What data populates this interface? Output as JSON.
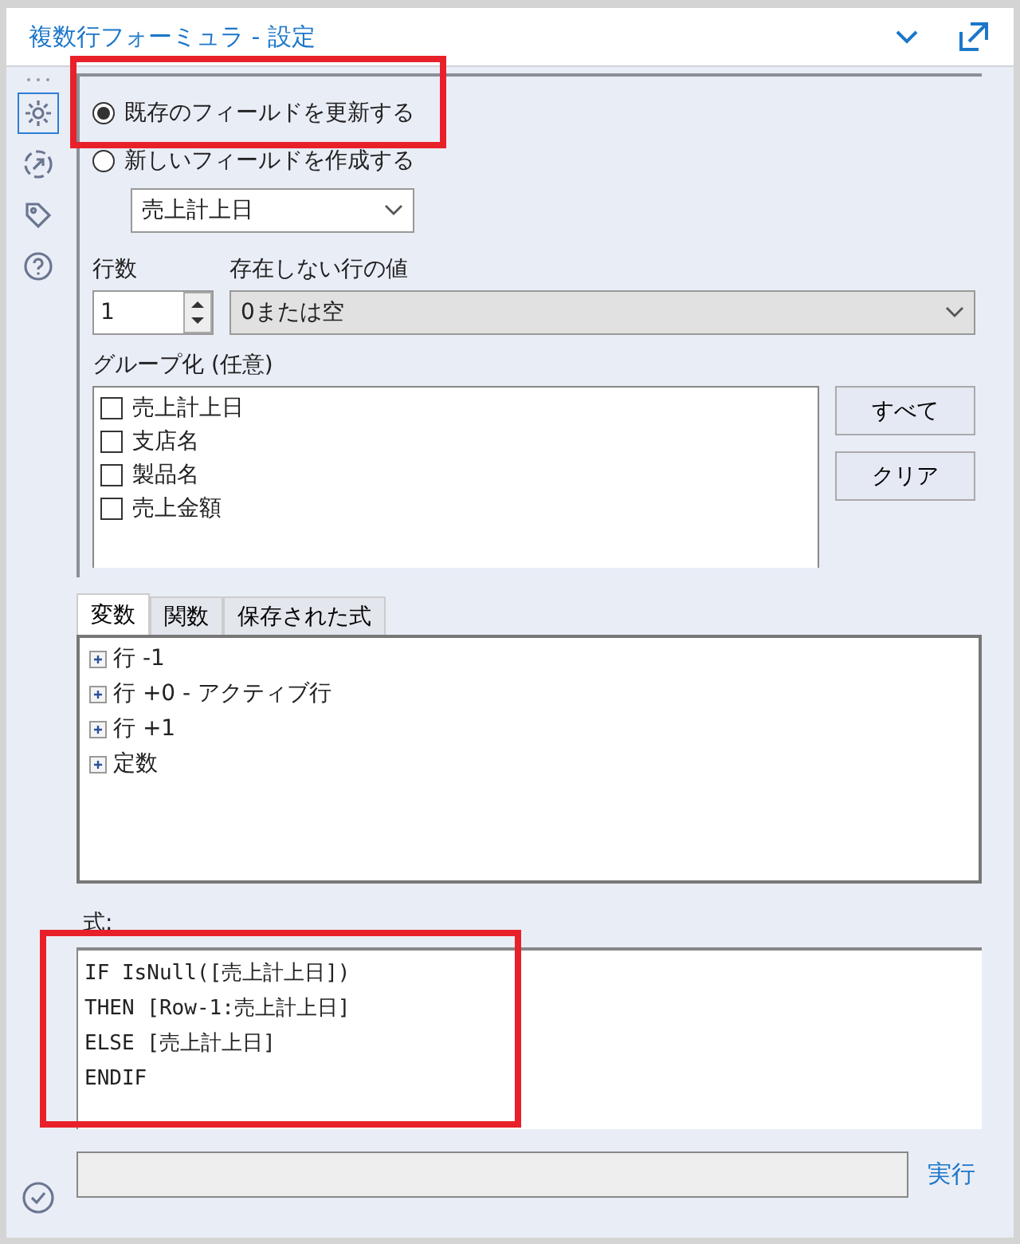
{
  "window": {
    "title": "複数行フォーミュラ - 設定"
  },
  "rail": [
    {
      "kind": "dots"
    },
    {
      "kind": "gear",
      "selected": true
    },
    {
      "kind": "connect",
      "selected": false
    },
    {
      "kind": "tag",
      "selected": false
    },
    {
      "kind": "help",
      "selected": false
    }
  ],
  "mode_options": [
    {
      "label": "既存のフィールドを更新する",
      "selected": true
    },
    {
      "label": "新しいフィールドを作成する",
      "selected": false
    }
  ],
  "field_dropdown": {
    "value": "売上計上日"
  },
  "row_count": {
    "label": "行数",
    "value": "1"
  },
  "missing_rows": {
    "label": "存在しない行の値",
    "value": "0または空"
  },
  "grouping": {
    "label": "グループ化 (任意)",
    "items": [
      {
        "label": "売上計上日",
        "checked": false
      },
      {
        "label": "支店名",
        "checked": false
      },
      {
        "label": "製品名",
        "checked": false
      },
      {
        "label": "売上金額",
        "checked": false
      }
    ],
    "buttons": [
      "すべて",
      "クリア"
    ]
  },
  "tabs": [
    {
      "label": "変数",
      "selected": true
    },
    {
      "label": "関数",
      "selected": false
    },
    {
      "label": "保存された式",
      "selected": false
    }
  ],
  "tree": [
    {
      "label": "行 -1",
      "expanded": false
    },
    {
      "label": "行 +0 - アクティブ行",
      "expanded": false
    },
    {
      "label": "行 +1",
      "expanded": false
    },
    {
      "label": "定数",
      "expanded": false
    }
  ],
  "expression": {
    "label": "式:",
    "lines": [
      "IF IsNull([売上計上日])",
      "THEN [Row-1:売上計上日]",
      "ELSE [売上計上日]",
      "ENDIF"
    ]
  },
  "run_button": "実行"
}
